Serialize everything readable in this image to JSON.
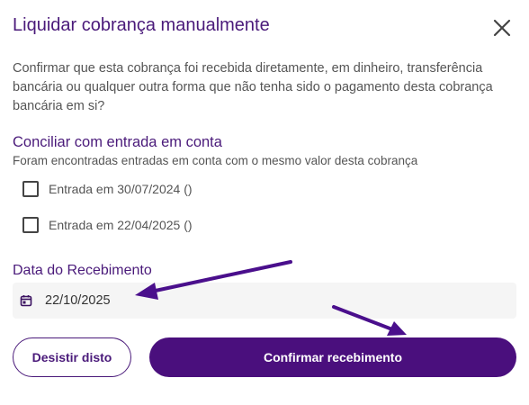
{
  "dialog": {
    "title": "Liquidar cobrança manualmente",
    "close_icon": "close-icon",
    "description": "Confirmar que esta cobrança foi recebida diretamente, em dinheiro, transferência bancária ou qualquer outra forma que não tenha sido o pagamento desta cobrança bancária em si?"
  },
  "reconcile": {
    "title": "Conciliar com entrada em conta",
    "subtitle": "Foram encontradas entradas em conta com o mesmo valor desta cobrança",
    "entries": [
      {
        "label": "Entrada em 30/07/2024 ()",
        "checked": false
      },
      {
        "label": "Entrada em 22/04/2025 ()",
        "checked": false
      }
    ]
  },
  "receipt_date": {
    "label": "Data do Recebimento",
    "value": "22/10/2025",
    "icon": "calendar-icon"
  },
  "actions": {
    "cancel_label": "Desistir disto",
    "confirm_label": "Confirmar recebimento"
  },
  "colors": {
    "accent": "#4a1a7a",
    "primary_button": "#4a0f7d",
    "annotation_arrow": "#4a0f8c"
  }
}
